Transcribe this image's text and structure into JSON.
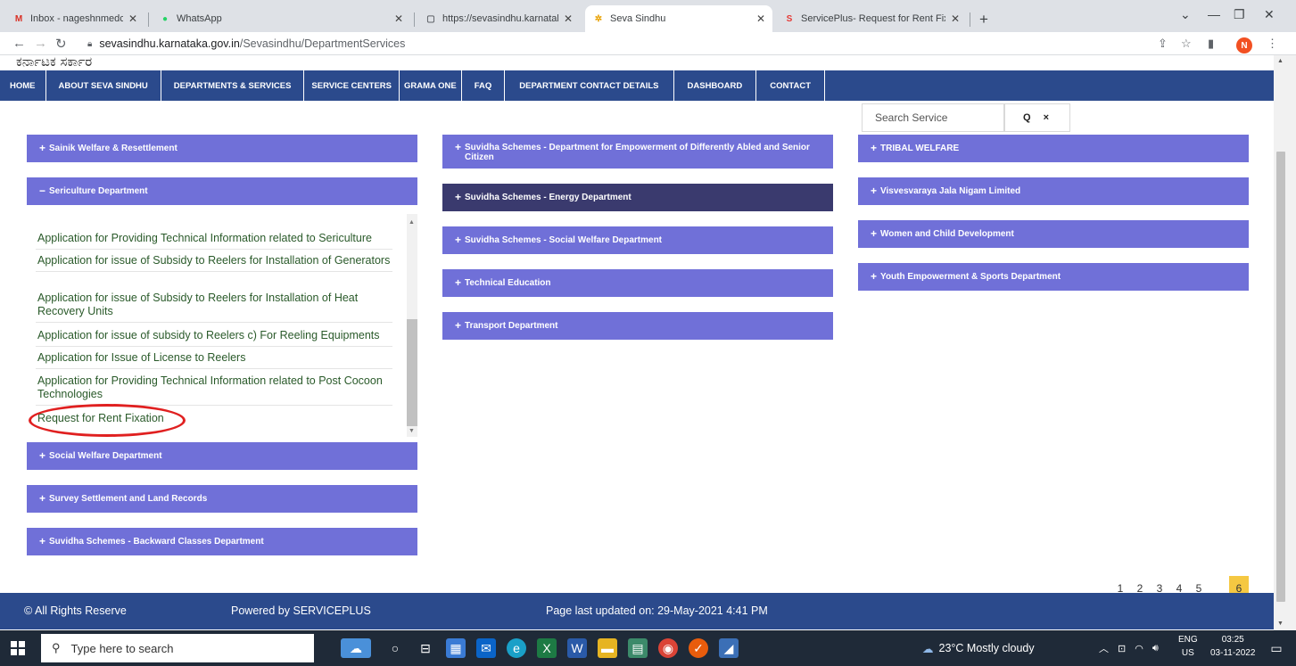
{
  "browser": {
    "tabs": [
      {
        "label": "Inbox - nageshnmedcs@gmail.co",
        "icon": "M",
        "icon_color": "#d93025"
      },
      {
        "label": "WhatsApp",
        "icon": "●",
        "icon_color": "#25d366"
      },
      {
        "label": "https://sevasindhu.karnataka.gov",
        "icon": "▢",
        "icon_color": "#5f6368"
      },
      {
        "label": "Seva Sindhu",
        "icon": "✲",
        "icon_color": "#e8a000"
      },
      {
        "label": "ServicePlus- Request for Rent Fix",
        "icon": "S",
        "icon_color": "#e53935"
      }
    ],
    "new_tab": "+",
    "url_host": "sevasindhu.karnataka.gov.in",
    "url_path": "/Sevasindhu/DepartmentServices",
    "profile_initial": "N"
  },
  "header": {
    "kannada_title": "ಕರ್ನಾಟಕ ಸರ್ಕಾರ"
  },
  "nav": {
    "items": [
      "HOME",
      "ABOUT SEVA SINDHU",
      "DEPARTMENTS & SERVICES",
      "SERVICE CENTERS",
      "GRAMA ONE",
      "FAQ",
      "DEPARTMENT CONTACT DETAILS",
      "DASHBOARD",
      "CONTACT"
    ]
  },
  "search": {
    "placeholder": "Search Service",
    "search_icon": "Q",
    "clear_icon": "×"
  },
  "departments": {
    "col1": [
      {
        "label": "Sainik Welfare & Resettlement",
        "sign": "+"
      },
      {
        "label": "Sericulture Department",
        "sign": "−"
      },
      {
        "label": "Social Welfare Department",
        "sign": "+"
      },
      {
        "label": "Survey Settlement and Land Records",
        "sign": "+"
      },
      {
        "label": "Suvidha Schemes - Backward Classes Department",
        "sign": "+"
      }
    ],
    "col2": [
      {
        "label": "Suvidha Schemes - Department for Empowerment of Differently Abled and Senior Citizen",
        "sign": "+"
      },
      {
        "label": "Suvidha Schemes - Energy Department",
        "sign": "+"
      },
      {
        "label": "Suvidha Schemes - Social Welfare Department",
        "sign": "+"
      },
      {
        "label": "Technical Education",
        "sign": "+"
      },
      {
        "label": "Transport Department",
        "sign": "+"
      }
    ],
    "col3": [
      {
        "label": "TRIBAL WELFARE",
        "sign": "+"
      },
      {
        "label": "Visvesvaraya Jala Nigam Limited",
        "sign": "+"
      },
      {
        "label": "Women and Child Development",
        "sign": "+"
      },
      {
        "label": "Youth Empowerment & Sports Department",
        "sign": "+"
      }
    ]
  },
  "sericulture_services": [
    "Application for Providing Technical Information related to Sericulture",
    "Application for issue of Subsidy to Reelers for Installation of Generators",
    "Application for issue of Subsidy to Reelers for Installation of Heat Recovery Units",
    "Application for issue of subsidy to Reelers c) For Reeling Equipments",
    "Application for Issue of License to Reelers",
    "Application for Providing Technical Information related to Post Cocoon Technologies",
    "Request for Rent Fixation"
  ],
  "pagination": {
    "pages": [
      "1",
      "2",
      "3",
      "4",
      "5",
      "6"
    ],
    "current": "6"
  },
  "footer": {
    "rights": "© All Rights Reserve",
    "powered": "Powered by SERVICEPLUS",
    "updated": "Page last updated on: 29-May-2021 4:41 PM"
  },
  "taskbar": {
    "search_placeholder": "Type here to search",
    "weather": "23°C  Mostly cloudy",
    "lang_top": "ENG",
    "lang_bottom": "US",
    "time": "03:25",
    "date": "03-11-2022"
  },
  "colors": {
    "navbar": "#2b4a8c",
    "dept_tile": "#7070d8",
    "dept_tile_active": "#3a3a6e",
    "service_text": "#2a5a2a",
    "pager_active": "#f5c842",
    "annotation": "#e02020"
  }
}
